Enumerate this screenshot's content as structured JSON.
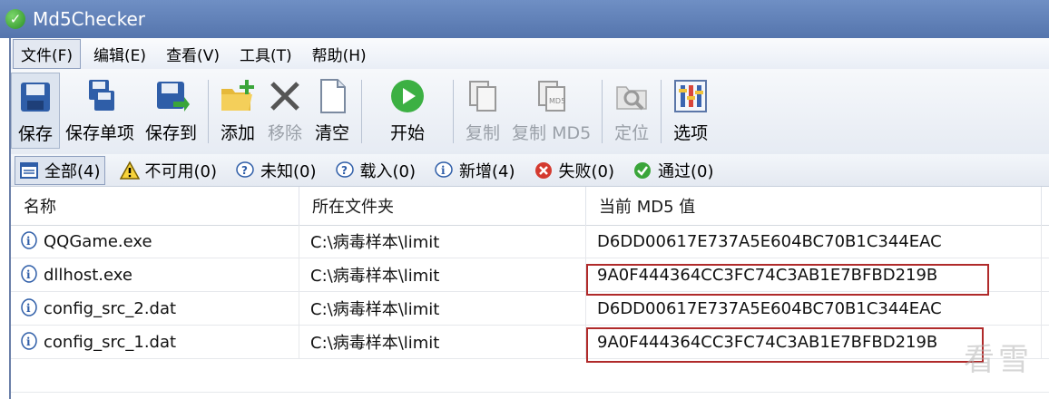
{
  "window": {
    "title": "Md5Checker"
  },
  "menu": [
    {
      "label": "文件(F)",
      "name": "menu-file"
    },
    {
      "label": "编辑(E)",
      "name": "menu-edit"
    },
    {
      "label": "查看(V)",
      "name": "menu-view"
    },
    {
      "label": "工具(T)",
      "name": "menu-tools"
    },
    {
      "label": "帮助(H)",
      "name": "menu-help"
    }
  ],
  "toolbar": {
    "save": "保存",
    "save_item": "保存单项",
    "save_to": "保存到",
    "add": "添加",
    "remove": "移除",
    "clear": "清空",
    "start": "开始",
    "copy": "复制",
    "copy_md5": "复制 MD5",
    "locate": "定位",
    "options": "选项"
  },
  "filters": {
    "all": "全部(4)",
    "unavailable": "不可用(0)",
    "unknown": "未知(0)",
    "loaded": "载入(0)",
    "new": "新增(4)",
    "failed": "失败(0)",
    "passed": "通过(0)"
  },
  "table": {
    "headers": [
      "名称",
      "所在文件夹",
      "当前 MD5 值"
    ],
    "rows": [
      {
        "name": "QQGame.exe",
        "folder": "C:\\病毒样本\\limit",
        "md5": "D6DD00617E737A5E604BC70B1C344EAC"
      },
      {
        "name": "dllhost.exe",
        "folder": "C:\\病毒样本\\limit",
        "md5": "9A0F444364CC3FC74C3AB1E7BFBD219B"
      },
      {
        "name": "config_src_2.dat",
        "folder": "C:\\病毒样本\\limit",
        "md5": "D6DD00617E737A5E604BC70B1C344EAC"
      },
      {
        "name": "config_src_1.dat",
        "folder": "C:\\病毒样本\\limit",
        "md5": "9A0F444364CC3FC74C3AB1E7BFBD219B"
      }
    ]
  },
  "watermark": "看雪",
  "icons": {
    "app": "check-circle-icon",
    "row": "info-download-icon"
  },
  "colors": {
    "titlebar": "#5f7fb8",
    "highlight": "#b02a2a",
    "disabled_text": "#9aa0a8"
  }
}
